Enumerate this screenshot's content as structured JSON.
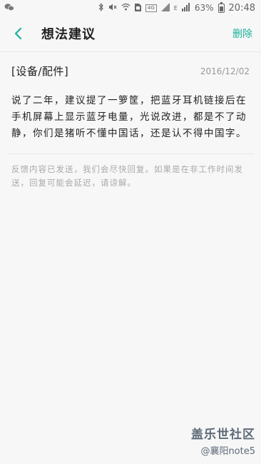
{
  "status_bar": {
    "battery_percent": "63%",
    "time": "20:48",
    "network_label_1": "4G",
    "network_label_2": "E"
  },
  "header": {
    "title": "想法建议",
    "delete_label": "删除"
  },
  "feedback": {
    "category": "[设备/配件]",
    "date": "2016/12/02",
    "message": "说了二年，建议提了一箩筐，把蓝牙耳机链接后在手机屏幕上显示蓝牙电量，光说改进，都是不了动静，你们是猪听不懂中国话，还是认不得中国字。",
    "notice": "反馈内容已发送，我们会尽快回复。如果是在非工作时间发送，回复可能会延迟，请谅解。"
  },
  "watermark": {
    "line1": "盖乐世社区",
    "line2": "@襄阳note5"
  },
  "colors": {
    "accent": "#1bb19a",
    "background": "#f7f7f7"
  }
}
